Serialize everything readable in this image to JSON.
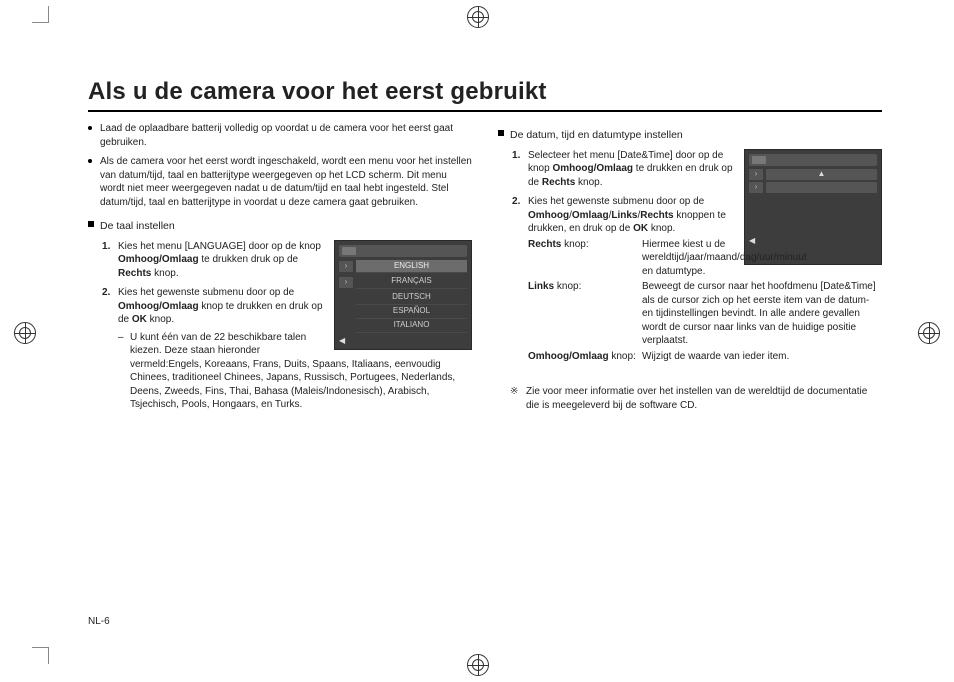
{
  "page_number": "NL-6",
  "title": "Als u de camera voor het eerst gebruikt",
  "intro_bullets": [
    "Laad de oplaadbare batterij volledig op voordat u de camera voor het eerst gaat gebruiken.",
    "Als de camera voor het eerst wordt ingeschakeld, wordt een menu voor het instellen van datum/tijd, taal en batterijtype weergegeven op het LCD scherm. Dit menu wordt niet meer weergegeven nadat u de datum/tijd en taal hebt ingesteld. Stel datum/tijd, taal en batterijtype in voordat u deze camera gaat gebruiken."
  ],
  "lang_section": {
    "heading": "De taal instellen",
    "step1_pre": "Kies het menu [LANGUAGE] door op de knop ",
    "step1_bold1": "Omhoog/Omlaag",
    "step1_mid": " te drukken druk op de ",
    "step1_bold2": "Rechts",
    "step1_post": " knop.",
    "step2_pre": "Kies het gewenste submenu door op de ",
    "step2_bold1": "Omhoog/Omlaag",
    "step2_mid": " knop te drukken en druk op de ",
    "step2_bold2": "OK",
    "step2_post": " knop.",
    "sub": "U kunt één van de 22 beschikbare talen kiezen. Deze staan hieronder vermeld:Engels, Koreaans, Frans, Duits, Spaans, Italiaans, eenvoudig Chinees, traditioneel Chinees, Japans, Russisch, Portugees, Nederlands, Deens, Zweeds, Fins, Thai, Bahasa (Maleis/Indonesisch), Arabisch, Tsjechisch, Pools, Hongaars, en Turks.",
    "lcd_options": [
      "ENGLISH",
      "FRANÇAIS",
      "DEUTSCH",
      "ESPAÑOL",
      "ITALIANO"
    ]
  },
  "dt_section": {
    "heading": "De datum, tijd en datumtype instellen",
    "step1_pre": "Selecteer het menu [Date&Time] door op de knop ",
    "step1_bold1": "Omhoog/Omlaag",
    "step1_mid": " te drukken en druk op de ",
    "step1_bold2": "Rechts",
    "step1_post": " knop.",
    "step2_pre": "Kies het gewenste submenu door op de ",
    "step2_bold1": "Omhoog",
    "step2_s1": "/",
    "step2_bold2": "Omlaag",
    "step2_s2": "/",
    "step2_bold3": "Links",
    "step2_s3": "/",
    "step2_bold4": "Rechts",
    "step2_mid": " knoppen te drukken, en druk op de ",
    "step2_bold5": "OK",
    "step2_post": " knop.",
    "defs": [
      {
        "label_bold": "Rechts",
        "label_post": " knop:",
        "value": "Hiermee kiest u de wereldtijd/jaar/maand/dag/uur/minuut en datumtype."
      },
      {
        "label_bold": "Links",
        "label_post": " knop:",
        "value": "Beweegt de cursor naar het hoofdmenu [Date&Time] als de cursor zich op het eerste item van de datum- en tijdinstellingen bevindt. In alle andere gevallen wordt de cursor naar links van de huidige positie verplaatst."
      },
      {
        "label_bold": "Omhoog/Omlaag",
        "label_post": " knop:",
        "value": "Wijzigt de waarde van ieder item."
      }
    ],
    "note": "Zie voor meer informatie over het instellen van de wereldtijd de documentatie die is meegeleverd bij de software CD."
  }
}
